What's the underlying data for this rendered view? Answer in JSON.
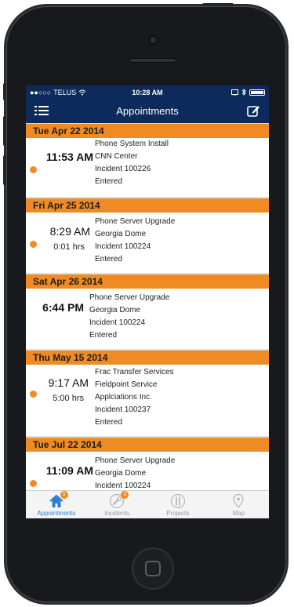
{
  "status_bar": {
    "carrier": "TELUS",
    "time": "10:28 AM"
  },
  "nav": {
    "title": "Appointments",
    "left_icon": "menu-list-icon",
    "right_icon": "compose-icon"
  },
  "days": [
    {
      "date": "Tue Apr 22 2014",
      "appointment": {
        "time": "11:53 AM",
        "duration": "",
        "lines": [
          "Phone System Install",
          "CNN Center",
          "Incident 100226",
          "Entered"
        ],
        "has_dot": true
      }
    },
    {
      "date": "Fri Apr 25 2014",
      "appointment": {
        "time": "8:29 AM",
        "duration": "0:01 hrs",
        "lines": [
          "Phone Server Upgrade",
          "Georgia Dome",
          "Incident 100224",
          "Entered"
        ],
        "has_dot": true
      }
    },
    {
      "date": "Sat Apr 26 2014",
      "appointment": {
        "time": "6:44 PM",
        "duration": "",
        "lines": [
          "Phone Server Upgrade",
          "Georgia Dome",
          "Incident 100224",
          "Entered"
        ],
        "has_dot": false
      }
    },
    {
      "date": "Thu May 15 2014",
      "appointment": {
        "time": "9:17 AM",
        "duration": "5:00 hrs",
        "lines": [
          "Frac Transfer Services",
          "Fieldpoint Service",
          "Applciations Inc.",
          "Incident 100237",
          "Entered"
        ],
        "has_dot": true
      }
    },
    {
      "date": "Tue Jul 22 2014",
      "appointment": {
        "time": "11:09 AM",
        "duration": "",
        "lines": [
          "Phone Server Upgrade",
          "Georgia Dome",
          "Incident 100224"
        ],
        "has_dot": true
      }
    }
  ],
  "tabs": [
    {
      "label": "Appointments",
      "icon": "home-icon",
      "badge": "5",
      "active": true
    },
    {
      "label": "Incidents",
      "icon": "wrench-icon",
      "badge": "5",
      "active": false
    },
    {
      "label": "Projects",
      "icon": "clipboard-icon",
      "badge": "",
      "active": false
    },
    {
      "label": "Map",
      "icon": "map-pin-icon",
      "badge": "",
      "active": false
    }
  ],
  "colors": {
    "nav_bg": "#0c2a5b",
    "accent": "#f08b24",
    "active_tab": "#2b7fd1"
  }
}
